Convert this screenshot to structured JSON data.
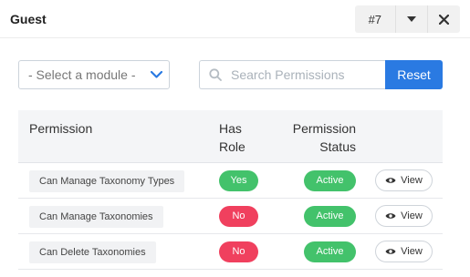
{
  "header": {
    "title": "Guest",
    "record_number": "#7",
    "dropdown_icon": "caret-down-icon",
    "close_icon": "close-icon"
  },
  "filters": {
    "module_select": "- Select a module -",
    "search_placeholder": "Search Permissions",
    "search_value": "",
    "reset_label": "Reset"
  },
  "table": {
    "columns": {
      "permission": "Permission",
      "has_role": "Has Role",
      "permission_status": "Permission Status"
    },
    "rows": [
      {
        "permission": "Can Manage Taxonomy Types",
        "has_role": "Yes",
        "status": "Active",
        "action": "View"
      },
      {
        "permission": "Can Manage Taxonomies",
        "has_role": "No",
        "status": "Active",
        "action": "View"
      },
      {
        "permission": "Can Delete Taxonomies",
        "has_role": "No",
        "status": "Active",
        "action": "View"
      }
    ]
  },
  "colors": {
    "primary": "#2a7ae2",
    "yes": "#43c26b",
    "no": "#f0405e",
    "active": "#43c26b",
    "chevron": "#2a7ae2"
  }
}
